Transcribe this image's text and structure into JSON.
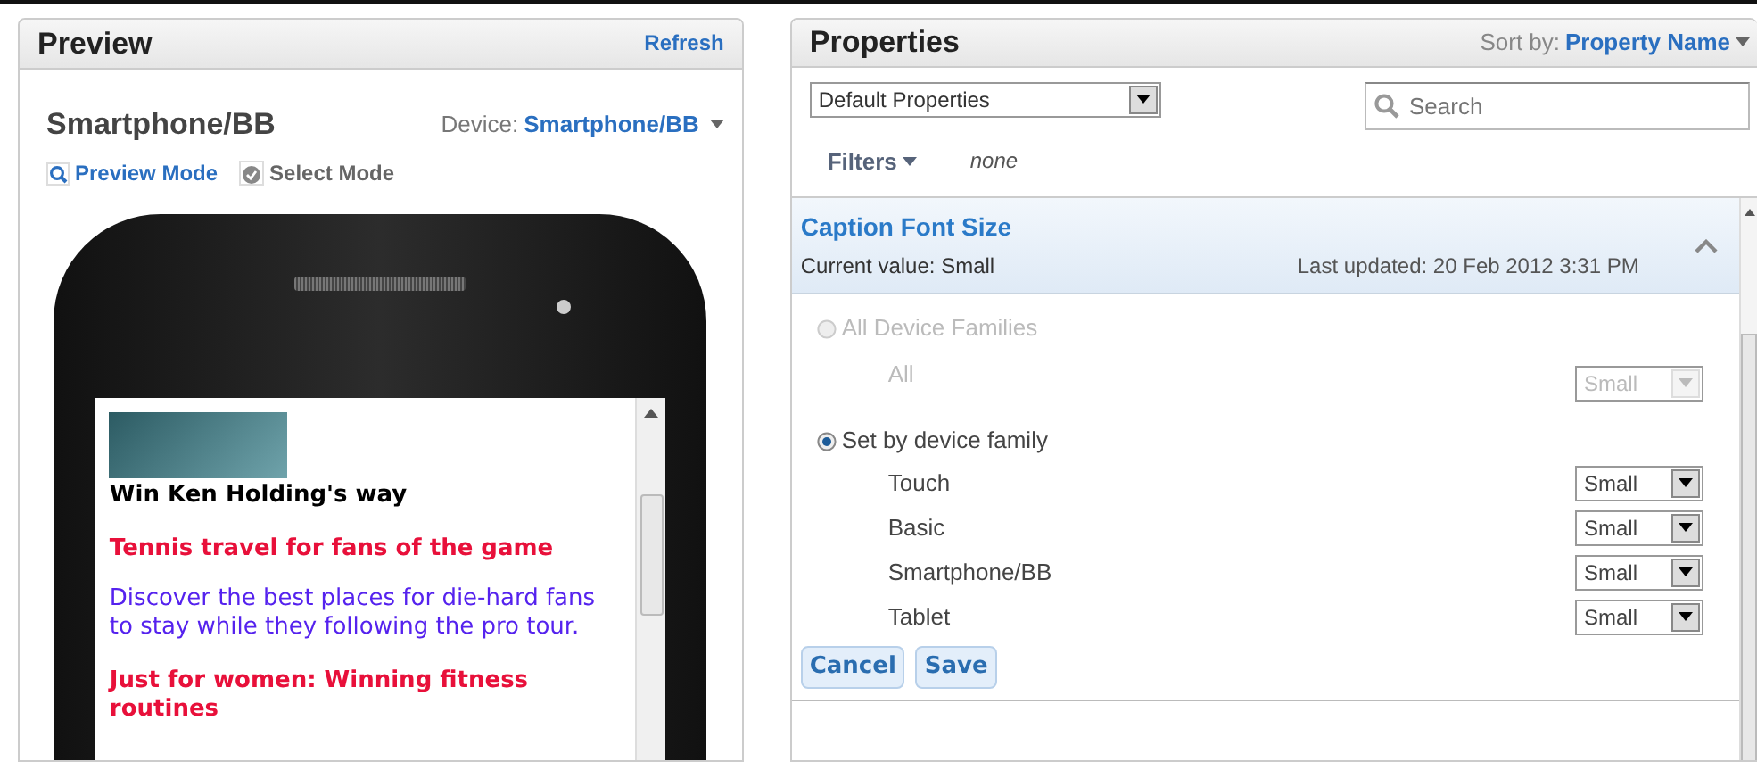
{
  "preview": {
    "title": "Preview",
    "refresh": "Refresh",
    "device_name": "Smartphone/BB",
    "device_label": "Device:",
    "device_value": "Smartphone/BB",
    "modes": [
      {
        "kind": "preview",
        "label": "Preview Mode",
        "selected": true
      },
      {
        "kind": "select",
        "label": "Select Mode",
        "selected": false
      }
    ],
    "screen_items": [
      {
        "kind": "heading",
        "text": "Win Ken Holding's way"
      },
      {
        "kind": "link",
        "text": "Tennis travel for fans of the game"
      },
      {
        "kind": "body",
        "text": "Discover the best places for die-hard fans to stay while they following the pro tour."
      },
      {
        "kind": "link",
        "text": "Just for women: Winning fitness routines"
      }
    ]
  },
  "properties": {
    "title": "Properties",
    "sort_label": "Sort by:",
    "sort_value": "Property Name",
    "preset": "Default Properties",
    "search": {
      "placeholder": "Search"
    },
    "filters_label": "Filters",
    "filters_value": "none",
    "property": {
      "title": "Caption Font Size",
      "current": "Current value: Small",
      "updated": "Last updated: 20 Feb 2012 3:31 PM",
      "expanded": true,
      "options": [
        {
          "label": "All Device Families",
          "selected": false,
          "disabled": true,
          "rows": [
            {
              "label": "All",
              "value": "Small"
            }
          ]
        },
        {
          "label": "Set by device family",
          "selected": true,
          "disabled": false,
          "rows": [
            {
              "label": "Touch",
              "value": "Small"
            },
            {
              "label": "Basic",
              "value": "Small"
            },
            {
              "label": "Smartphone/BB",
              "value": "Small"
            },
            {
              "label": "Tablet",
              "value": "Small"
            }
          ]
        }
      ],
      "buttons": [
        "Cancel",
        "Save"
      ]
    }
  }
}
